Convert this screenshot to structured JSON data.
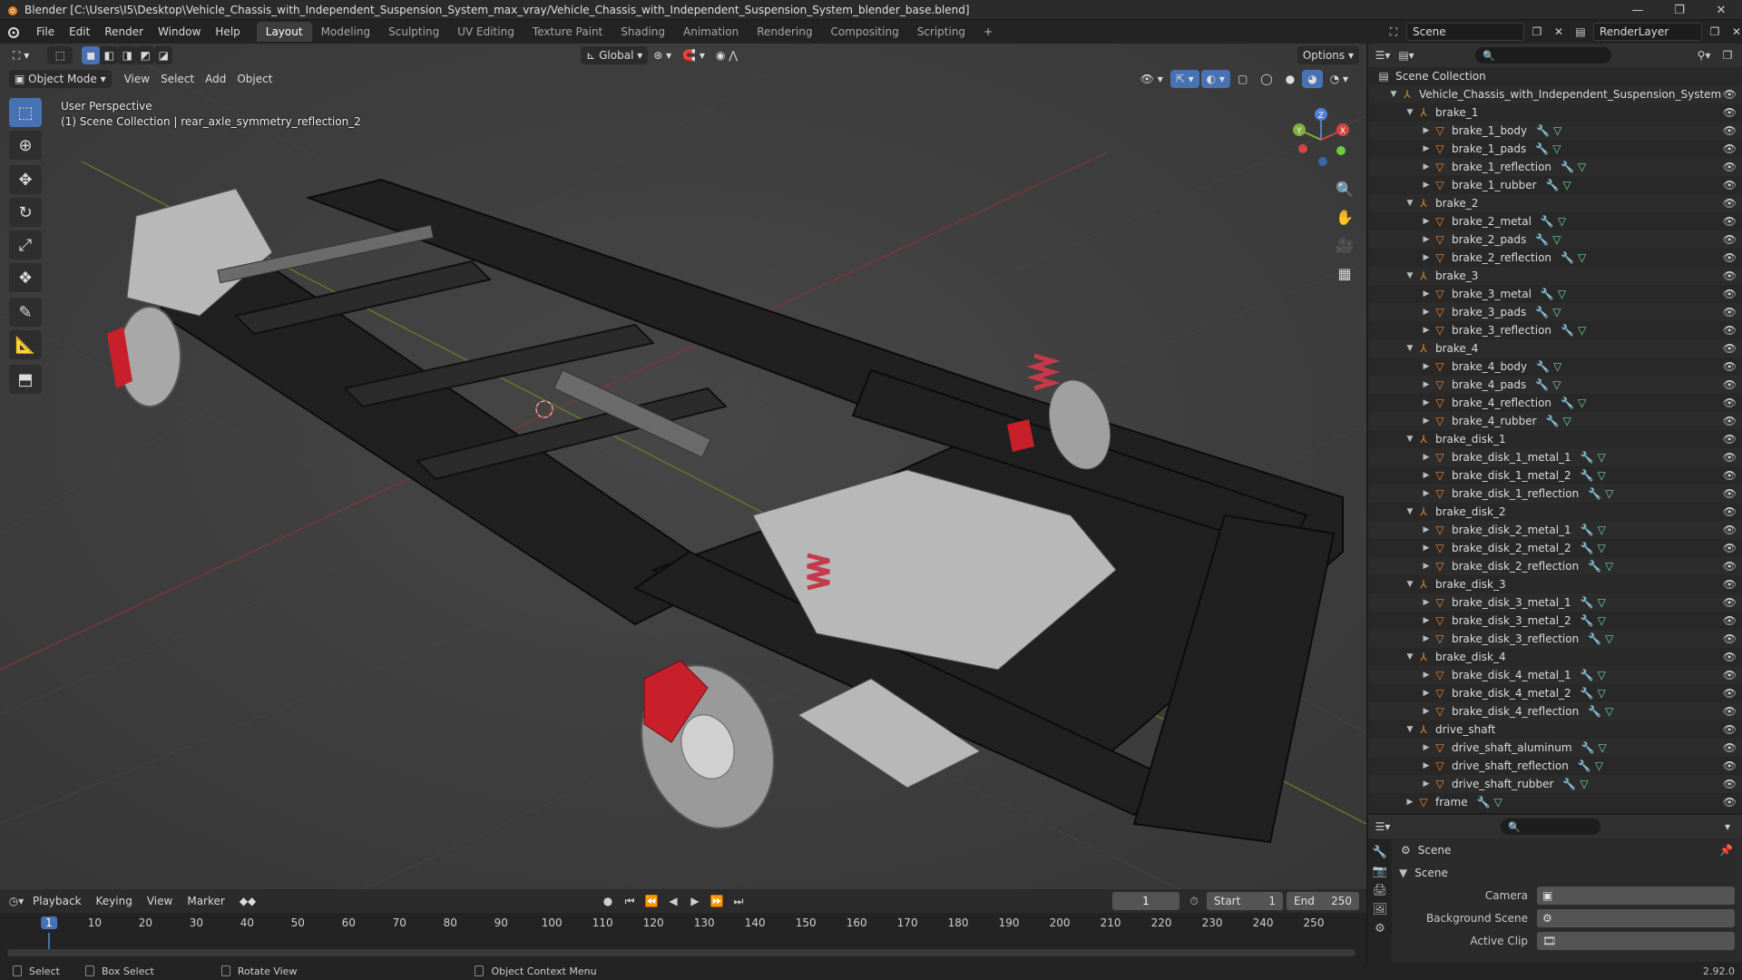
{
  "window": {
    "title": "Blender [C:\\Users\\I5\\Desktop\\Vehicle_Chassis_with_Independent_Suspension_System_max_vray/Vehicle_Chassis_with_Independent_Suspension_System_blender_base.blend]",
    "controls": [
      "—",
      "❐",
      "✕"
    ]
  },
  "menu": [
    "File",
    "Edit",
    "Render",
    "Window",
    "Help"
  ],
  "workspaces": [
    "Layout",
    "Modeling",
    "Sculpting",
    "UV Editing",
    "Texture Paint",
    "Shading",
    "Animation",
    "Rendering",
    "Compositing",
    "Scripting"
  ],
  "active_workspace": "Layout",
  "scene_name": "Scene",
  "render_layer": "RenderLayer",
  "viewport": {
    "transform_orientation": "Global",
    "options_label": "Options",
    "mode": "Object Mode",
    "header_menus": [
      "View",
      "Select",
      "Add",
      "Object"
    ],
    "perspective": "User Perspective",
    "context": "(1) Scene Collection | rear_axle_symmetry_reflection_2",
    "gizmo_axes": {
      "x": "X",
      "y": "Y",
      "z": "Z"
    }
  },
  "outliner": {
    "root": "Scene Collection",
    "items": [
      {
        "level": 1,
        "type": "collection",
        "name": "Vehicle_Chassis_with_Independent_Suspension_System",
        "expanded": true
      },
      {
        "level": 2,
        "type": "collection",
        "name": "brake_1",
        "expanded": true
      },
      {
        "level": 3,
        "type": "mesh",
        "name": "brake_1_body"
      },
      {
        "level": 3,
        "type": "mesh",
        "name": "brake_1_pads"
      },
      {
        "level": 3,
        "type": "mesh",
        "name": "brake_1_reflection"
      },
      {
        "level": 3,
        "type": "mesh",
        "name": "brake_1_rubber"
      },
      {
        "level": 2,
        "type": "collection",
        "name": "brake_2",
        "expanded": true
      },
      {
        "level": 3,
        "type": "mesh",
        "name": "brake_2_metal"
      },
      {
        "level": 3,
        "type": "mesh",
        "name": "brake_2_pads"
      },
      {
        "level": 3,
        "type": "mesh",
        "name": "brake_2_reflection"
      },
      {
        "level": 2,
        "type": "collection",
        "name": "brake_3",
        "expanded": true
      },
      {
        "level": 3,
        "type": "mesh",
        "name": "brake_3_metal"
      },
      {
        "level": 3,
        "type": "mesh",
        "name": "brake_3_pads"
      },
      {
        "level": 3,
        "type": "mesh",
        "name": "brake_3_reflection"
      },
      {
        "level": 2,
        "type": "collection",
        "name": "brake_4",
        "expanded": true
      },
      {
        "level": 3,
        "type": "mesh",
        "name": "brake_4_body"
      },
      {
        "level": 3,
        "type": "mesh",
        "name": "brake_4_pads"
      },
      {
        "level": 3,
        "type": "mesh",
        "name": "brake_4_reflection"
      },
      {
        "level": 3,
        "type": "mesh",
        "name": "brake_4_rubber"
      },
      {
        "level": 2,
        "type": "collection",
        "name": "brake_disk_1",
        "expanded": true
      },
      {
        "level": 3,
        "type": "mesh",
        "name": "brake_disk_1_metal_1"
      },
      {
        "level": 3,
        "type": "mesh",
        "name": "brake_disk_1_metal_2"
      },
      {
        "level": 3,
        "type": "mesh",
        "name": "brake_disk_1_reflection"
      },
      {
        "level": 2,
        "type": "collection",
        "name": "brake_disk_2",
        "expanded": true
      },
      {
        "level": 3,
        "type": "mesh",
        "name": "brake_disk_2_metal_1"
      },
      {
        "level": 3,
        "type": "mesh",
        "name": "brake_disk_2_metal_2"
      },
      {
        "level": 3,
        "type": "mesh",
        "name": "brake_disk_2_reflection"
      },
      {
        "level": 2,
        "type": "collection",
        "name": "brake_disk_3",
        "expanded": true
      },
      {
        "level": 3,
        "type": "mesh",
        "name": "brake_disk_3_metal_1"
      },
      {
        "level": 3,
        "type": "mesh",
        "name": "brake_disk_3_metal_2"
      },
      {
        "level": 3,
        "type": "mesh",
        "name": "brake_disk_3_reflection"
      },
      {
        "level": 2,
        "type": "collection",
        "name": "brake_disk_4",
        "expanded": true
      },
      {
        "level": 3,
        "type": "mesh",
        "name": "brake_disk_4_metal_1"
      },
      {
        "level": 3,
        "type": "mesh",
        "name": "brake_disk_4_metal_2"
      },
      {
        "level": 3,
        "type": "mesh",
        "name": "brake_disk_4_reflection"
      },
      {
        "level": 2,
        "type": "collection",
        "name": "drive_shaft",
        "expanded": true
      },
      {
        "level": 3,
        "type": "mesh",
        "name": "drive_shaft_aluminum"
      },
      {
        "level": 3,
        "type": "mesh",
        "name": "drive_shaft_reflection"
      },
      {
        "level": 3,
        "type": "mesh",
        "name": "drive_shaft_rubber"
      },
      {
        "level": 2,
        "type": "mesh",
        "name": "frame",
        "expanded": false
      }
    ]
  },
  "properties": {
    "breadcrumb": "Scene",
    "panel": "Scene",
    "rows": [
      {
        "label": "Camera",
        "value": ""
      },
      {
        "label": "Background Scene",
        "value": ""
      },
      {
        "label": "Active Clip",
        "value": ""
      }
    ]
  },
  "timeline": {
    "menus": [
      "Playback",
      "Keying",
      "View",
      "Marker"
    ],
    "current_frame": "1",
    "start_label": "Start",
    "start": "1",
    "end_label": "End",
    "end": "250",
    "ticks": [
      "1",
      "10",
      "20",
      "30",
      "40",
      "50",
      "60",
      "70",
      "80",
      "90",
      "100",
      "110",
      "120",
      "130",
      "140",
      "150",
      "160",
      "170",
      "180",
      "190",
      "200",
      "210",
      "220",
      "230",
      "240",
      "250"
    ]
  },
  "statusbar": {
    "select": "Select",
    "box_select": "Box Select",
    "rotate": "Rotate View",
    "context_menu": "Object Context Menu",
    "version": "2.92.0"
  },
  "colors": {
    "accent": "#4772b3",
    "collection_icon": "#d98b3a",
    "mesh_icon": "#f0883a",
    "modifier_icon": "#6cb6ff",
    "data_icon": "#70d8a8"
  }
}
